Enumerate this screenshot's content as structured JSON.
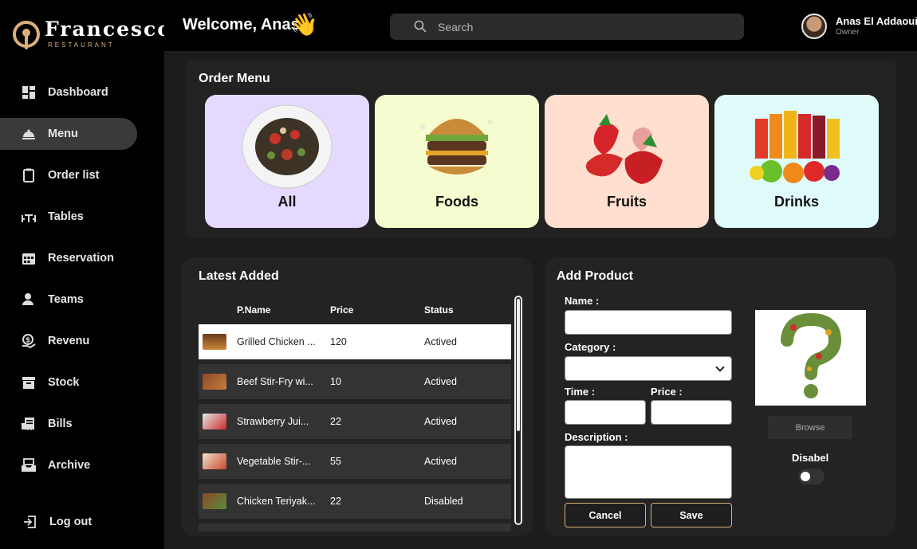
{
  "brand": {
    "name": "Francesco",
    "sub": "RESTAURANT",
    "accent": "#d9b07a"
  },
  "header": {
    "welcome": "Welcome, Anas",
    "wave": "👋",
    "search_placeholder": "Search",
    "user_name": "Anas El Addaoui",
    "user_role": "Owner"
  },
  "sidebar": {
    "items": [
      {
        "label": "Dashboard",
        "icon": "dashboard-icon"
      },
      {
        "label": "Menu",
        "icon": "menu-cloche-icon",
        "active": true
      },
      {
        "label": "Order list",
        "icon": "clipboard-icon"
      },
      {
        "label": "Tables",
        "icon": "table-icon"
      },
      {
        "label": "Reservation",
        "icon": "calendar-icon"
      },
      {
        "label": "Teams",
        "icon": "team-icon"
      },
      {
        "label": "Revenu",
        "icon": "revenue-icon"
      },
      {
        "label": "Stock",
        "icon": "archive-box-icon"
      },
      {
        "label": "Bills",
        "icon": "receipt-icon"
      },
      {
        "label": "Archive",
        "icon": "inbox-archive-icon"
      }
    ],
    "logout": "Log out"
  },
  "order_menu": {
    "title": "Order Menu",
    "categories": [
      {
        "label": "All",
        "color": "#e5d9ff"
      },
      {
        "label": "Foods",
        "color": "#f4fcd0"
      },
      {
        "label": "Fruits",
        "color": "#ffdfcf"
      },
      {
        "label": "Drinks",
        "color": "#dffcfa"
      }
    ]
  },
  "latest": {
    "title": "Latest Added",
    "columns": [
      "P.Name",
      "Price",
      "Status"
    ],
    "rows": [
      {
        "name": "Grilled Chicken ...",
        "price": "120",
        "status": "Actived"
      },
      {
        "name": "Beef Stir-Fry wi...",
        "price": "10",
        "status": "Actived"
      },
      {
        "name": "Strawberry Jui...",
        "price": "22",
        "status": "Actived"
      },
      {
        "name": "Vegetable Stir-...",
        "price": "55",
        "status": "Actived"
      },
      {
        "name": "Chicken Teriyak...",
        "price": "22",
        "status": "Disabled"
      }
    ]
  },
  "add_product": {
    "title": "Add Product",
    "name_label": "Name :",
    "category_label": "Category :",
    "time_label": "Time :",
    "price_label": "Price :",
    "description_label": "Description :",
    "cancel": "Cancel",
    "save": "Save",
    "browse": "Browse",
    "disable_label": "Disabel"
  }
}
